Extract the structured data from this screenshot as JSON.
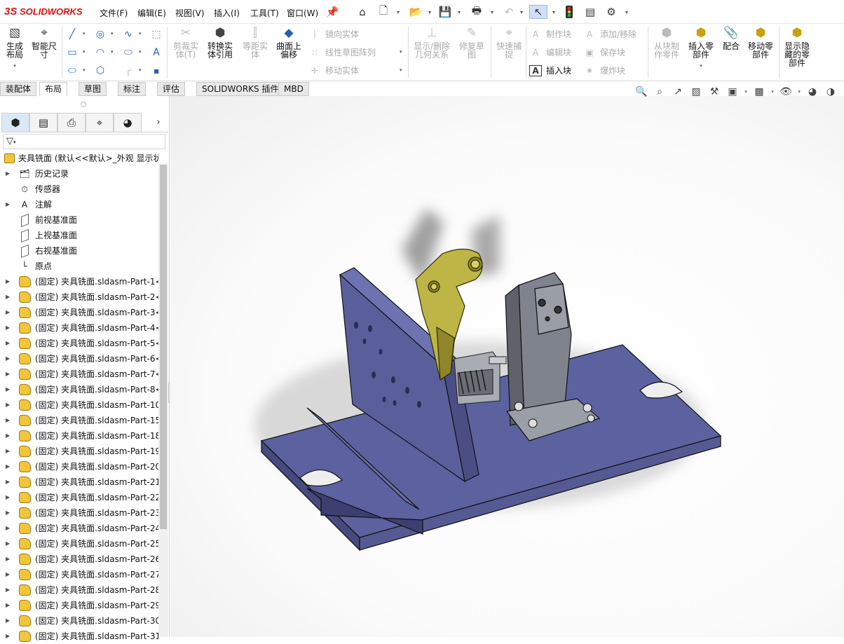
{
  "app": {
    "brand": "SOLIDWORKS",
    "brand_prefix": "3S"
  },
  "menu": [
    {
      "label": "文件(F)"
    },
    {
      "label": "编辑(E)"
    },
    {
      "label": "视图(V)"
    },
    {
      "label": "插入(I)"
    },
    {
      "label": "工具(T)"
    },
    {
      "label": "窗口(W)"
    }
  ],
  "quick_access": [
    "pin-icon",
    "home-icon",
    "new-document-icon",
    "open-icon",
    "save-icon",
    "print-icon",
    "undo-icon",
    "select-icon",
    "rebuild-icon",
    "file-properties-icon",
    "options-icon"
  ],
  "command_manager": {
    "layout_tools": {
      "generate_layout": "生成布局",
      "smart_dimension": "智能尺寸"
    },
    "sketch_tools_icons": [
      "line-icon",
      "circle-icon",
      "spline-icon",
      "rectangle-icon",
      "arc-icon",
      "ellipse-icon",
      "slot-icon",
      "polygon-icon",
      "fillet-icon",
      "text-icon",
      "point-icon"
    ],
    "trim_entities": "剪裁实体(T)",
    "convert_entities": "转换实体引用",
    "offset_entities": "等距实体",
    "offset_on_surface": "曲面上偏移",
    "mirror_entities": "镜向实体",
    "linear_pattern": "线性草图阵列",
    "move_entities": "移动实体",
    "display_delete_relations": "显示/删除几何关系",
    "repair_sketch": "修复草图",
    "quick_snaps": "快速捕捉",
    "make_block": "制作块",
    "edit_block": "编辑块",
    "insert_block": "插入块",
    "add_remove": "添加/移除",
    "save_block": "保存块",
    "explode_block": "爆炸块",
    "make_part_from_block": "从块制作零件",
    "insert_part": "插入零部件",
    "mate": "配合",
    "move_component": "移动零部件",
    "show_hidden_components": "显示隐藏的零部件"
  },
  "tabs": [
    {
      "label": "装配体"
    },
    {
      "label": "布局",
      "active": true
    },
    {
      "label": "草图"
    },
    {
      "label": "标注"
    },
    {
      "label": "评估"
    },
    {
      "label": "SOLIDWORKS 插件"
    },
    {
      "label": "MBD"
    }
  ],
  "feature_manager": {
    "panel_tabs": [
      "feature-manager-icon",
      "property-manager-icon",
      "configuration-manager-icon",
      "dimxpert-icon",
      "display-manager-icon"
    ],
    "root": "夹具铣面  (默认<<默认>_外观 显示状",
    "fixed_nodes": [
      {
        "label": "历史记录",
        "icon": "history-icon",
        "expandable": true
      },
      {
        "label": "传感器",
        "icon": "sensor-icon",
        "expandable": false
      },
      {
        "label": "注解",
        "icon": "annotation-icon",
        "expandable": true
      },
      {
        "label": "前视基准面",
        "icon": "plane-icon",
        "expandable": false
      },
      {
        "label": "上视基准面",
        "icon": "plane-icon",
        "expandable": false
      },
      {
        "label": "右视基准面",
        "icon": "plane-icon",
        "expandable": false
      },
      {
        "label": "原点",
        "icon": "origin-icon",
        "expandable": false
      }
    ],
    "parts": [
      "(固定) 夹具铣面.sldasm-Part-1<",
      "(固定) 夹具铣面.sldasm-Part-2<",
      "(固定) 夹具铣面.sldasm-Part-3<",
      "(固定) 夹具铣面.sldasm-Part-4<",
      "(固定) 夹具铣面.sldasm-Part-5<",
      "(固定) 夹具铣面.sldasm-Part-6<",
      "(固定) 夹具铣面.sldasm-Part-7<",
      "(固定) 夹具铣面.sldasm-Part-8<",
      "(固定) 夹具铣面.sldasm-Part-10",
      "(固定) 夹具铣面.sldasm-Part-15",
      "(固定) 夹具铣面.sldasm-Part-18",
      "(固定) 夹具铣面.sldasm-Part-19",
      "(固定) 夹具铣面.sldasm-Part-20",
      "(固定) 夹具铣面.sldasm-Part-21",
      "(固定) 夹具铣面.sldasm-Part-22",
      "(固定) 夹具铣面.sldasm-Part-23",
      "(固定) 夹具铣面.sldasm-Part-24",
      "(固定) 夹具铣面.sldasm-Part-25",
      "(固定) 夹具铣面.sldasm-Part-26",
      "(固定) 夹具铣面.sldasm-Part-27",
      "(固定) 夹具铣面.sldasm-Part-28",
      "(固定) 夹具铣面.sldasm-Part-29",
      "(固定) 夹具铣面.sldasm-Part-30",
      "(固定) 夹具铣面.sldasm-Part-31"
    ]
  },
  "heads_up_toolbar": [
    "zoom-to-fit-icon",
    "zoom-to-area-icon",
    "previous-view-icon",
    "section-view-icon",
    "dynamic-annotation-icon",
    "view-orientation-icon",
    "display-style-icon",
    "hide-show-items-icon",
    "edit-appearance-icon",
    "apply-scene-icon"
  ],
  "colors": {
    "base_plate": "#5d629b",
    "clamp_arm": "#b6ad3f",
    "support_block": "#7a7e88",
    "accent_red": "#d11d1d"
  }
}
